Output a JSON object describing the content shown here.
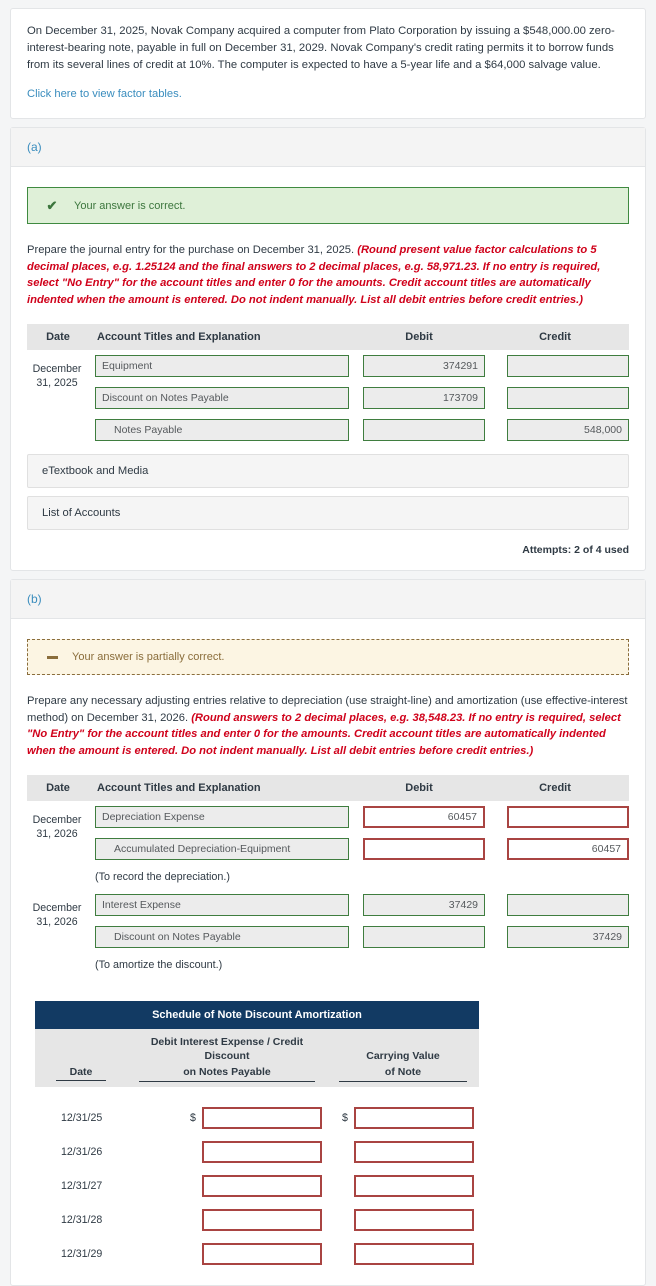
{
  "intro": {
    "paragraph": "On December 31, 2025, Novak Company acquired a computer from Plato Corporation by issuing a $548,000.00 zero-interest-bearing note, payable in full on December 31, 2029. Novak Company's credit rating permits it to borrow funds from its several lines of credit at 10%. The computer is expected to have a 5-year life and a $64,000 salvage value.",
    "factor_link": "Click here to view factor tables."
  },
  "colors": {
    "link": "#3a8dbe",
    "hint_red": "#d0021b",
    "correct_green": "#3f8a40",
    "partial_brown": "#8a6d3b",
    "error_red": "#a94442",
    "schedule_header": "#123a63"
  },
  "part_a": {
    "label": "(a)",
    "alert": {
      "icon": "check-icon",
      "message": "Your answer is correct."
    },
    "prompt_plain": "Prepare the journal entry for the purchase on December 31, 2025. ",
    "prompt_hint": "(Round present value factor calculations to 5 decimal places, e.g. 1.25124 and the final answers to 2 decimal places, e.g. 58,971.23. If no entry is required, select \"No Entry\" for the account titles and enter 0 for the amounts. Credit account titles are automatically indented when the amount is entered. Do not indent manually. List all debit entries before credit entries.)",
    "columns": {
      "date": "Date",
      "account": "Account Titles and Explanation",
      "debit": "Debit",
      "credit": "Credit"
    },
    "date_line1": "December",
    "date_line2": "31, 2025",
    "lines": [
      {
        "account": "Equipment",
        "indent": false,
        "debit": "374291",
        "credit": ""
      },
      {
        "account": "Discount on Notes Payable",
        "indent": false,
        "debit": "173709",
        "credit": ""
      },
      {
        "account": "Notes Payable",
        "indent": true,
        "debit": "",
        "credit": "548,000"
      }
    ],
    "etextbook_button": "eTextbook and Media",
    "list_accounts_button": "List of Accounts",
    "attempts": "Attempts: 2 of 4 used"
  },
  "part_b": {
    "label": "(b)",
    "alert": {
      "icon": "minus-icon",
      "message": "Your answer is partially correct."
    },
    "prompt_plain": "Prepare any necessary adjusting entries relative to depreciation (use straight-line) and amortization (use effective-interest method) on December 31, 2026. ",
    "prompt_hint": "(Round answers to 2 decimal places, e.g. 38,548.23. If no entry is required, select \"No Entry\" for the account titles and enter 0 for the amounts. Credit account titles are automatically indented when the amount is entered. Do not indent manually. List all debit entries before credit entries.)",
    "columns": {
      "date": "Date",
      "account": "Account Titles and Explanation",
      "debit": "Debit",
      "credit": "Credit"
    },
    "groups": [
      {
        "date_line1": "December",
        "date_line2": "31, 2026",
        "lines": [
          {
            "account": "Depreciation Expense",
            "indent": false,
            "debit": "60457",
            "credit": "",
            "debit_error": true,
            "credit_error": true
          },
          {
            "account": "Accumulated Depreciation-Equipment",
            "indent": true,
            "debit": "",
            "credit": "60457",
            "debit_error": true,
            "credit_error": true
          }
        ],
        "note": "(To record the depreciation.)"
      },
      {
        "date_line1": "December",
        "date_line2": "31, 2026",
        "lines": [
          {
            "account": "Interest Expense",
            "indent": false,
            "debit": "37429",
            "credit": "",
            "debit_error": false,
            "credit_error": false
          },
          {
            "account": "Discount on Notes Payable",
            "indent": true,
            "debit": "",
            "credit": "37429",
            "debit_error": false,
            "credit_error": false
          }
        ],
        "note": "(To amortize the discount.)"
      }
    ],
    "schedule": {
      "title": "Schedule of Note Discount Amortization",
      "col_date": "Date",
      "col_interest_line1": "Debit Interest Expense / Credit Discount",
      "col_interest_line2": "on Notes Payable",
      "col_carrying_line1": "Carrying Value",
      "col_carrying_line2": "of Note",
      "dollar": "$",
      "rows": [
        {
          "date": "12/31/25",
          "interest": "",
          "carrying": "",
          "show_dollar": true
        },
        {
          "date": "12/31/26",
          "interest": "",
          "carrying": "",
          "show_dollar": false
        },
        {
          "date": "12/31/27",
          "interest": "",
          "carrying": "",
          "show_dollar": false
        },
        {
          "date": "12/31/28",
          "interest": "",
          "carrying": "",
          "show_dollar": false
        },
        {
          "date": "12/31/29",
          "interest": "",
          "carrying": "",
          "show_dollar": false
        }
      ]
    }
  }
}
